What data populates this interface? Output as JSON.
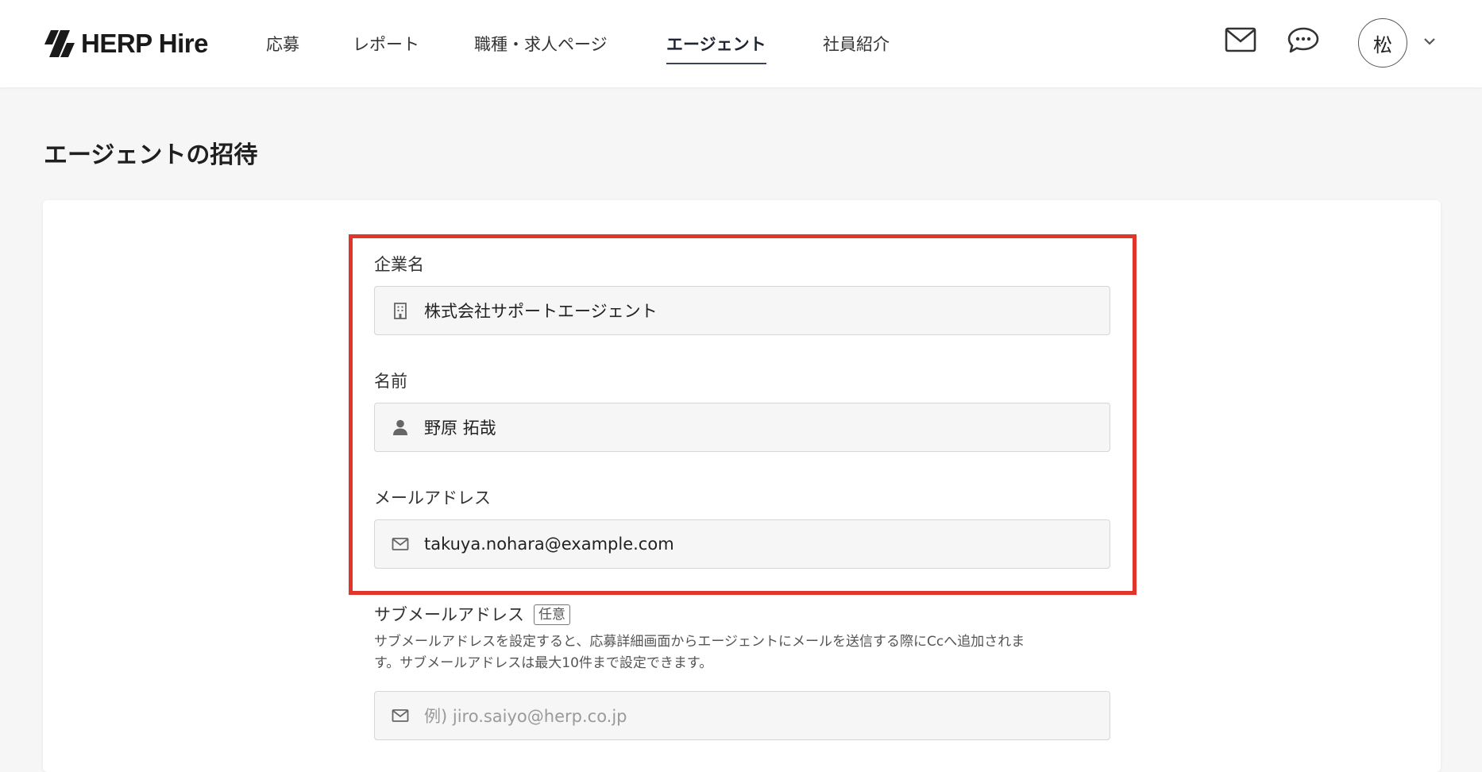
{
  "header": {
    "logo_text": "HERP Hire",
    "nav": [
      {
        "label": "応募",
        "active": false
      },
      {
        "label": "レポート",
        "active": false
      },
      {
        "label": "職種・求人ページ",
        "active": false
      },
      {
        "label": "エージェント",
        "active": true
      },
      {
        "label": "社員紹介",
        "active": false
      }
    ],
    "icons": [
      "mail-icon",
      "chat-bubble-icon",
      "chevron-down-icon"
    ],
    "avatar_initial": "松"
  },
  "page": {
    "title": "エージェントの招待"
  },
  "form": {
    "company": {
      "label": "企業名",
      "value": "株式会社サポートエージェント",
      "icon": "building-icon"
    },
    "name": {
      "label": "名前",
      "value": "野原 拓哉",
      "icon": "person-icon"
    },
    "email": {
      "label": "メールアドレス",
      "value": "takuya.nohara@example.com",
      "icon": "mail-icon"
    },
    "sub_email": {
      "label": "サブメールアドレス",
      "optional_tag": "任意",
      "help_line1": "サブメールアドレスを設定すると、応募詳細画面からエージェントにメールを送信する際にCcへ追加されま",
      "help_line2": "す。サブメールアドレスは最大10件まで設定できます。",
      "placeholder": "例) jiro.saiyo@herp.co.jp",
      "icon": "mail-icon"
    }
  },
  "colors": {
    "highlight": "#e0352b",
    "nav_active_underline": "#3b4556",
    "field_bg": "#f6f6f6"
  }
}
